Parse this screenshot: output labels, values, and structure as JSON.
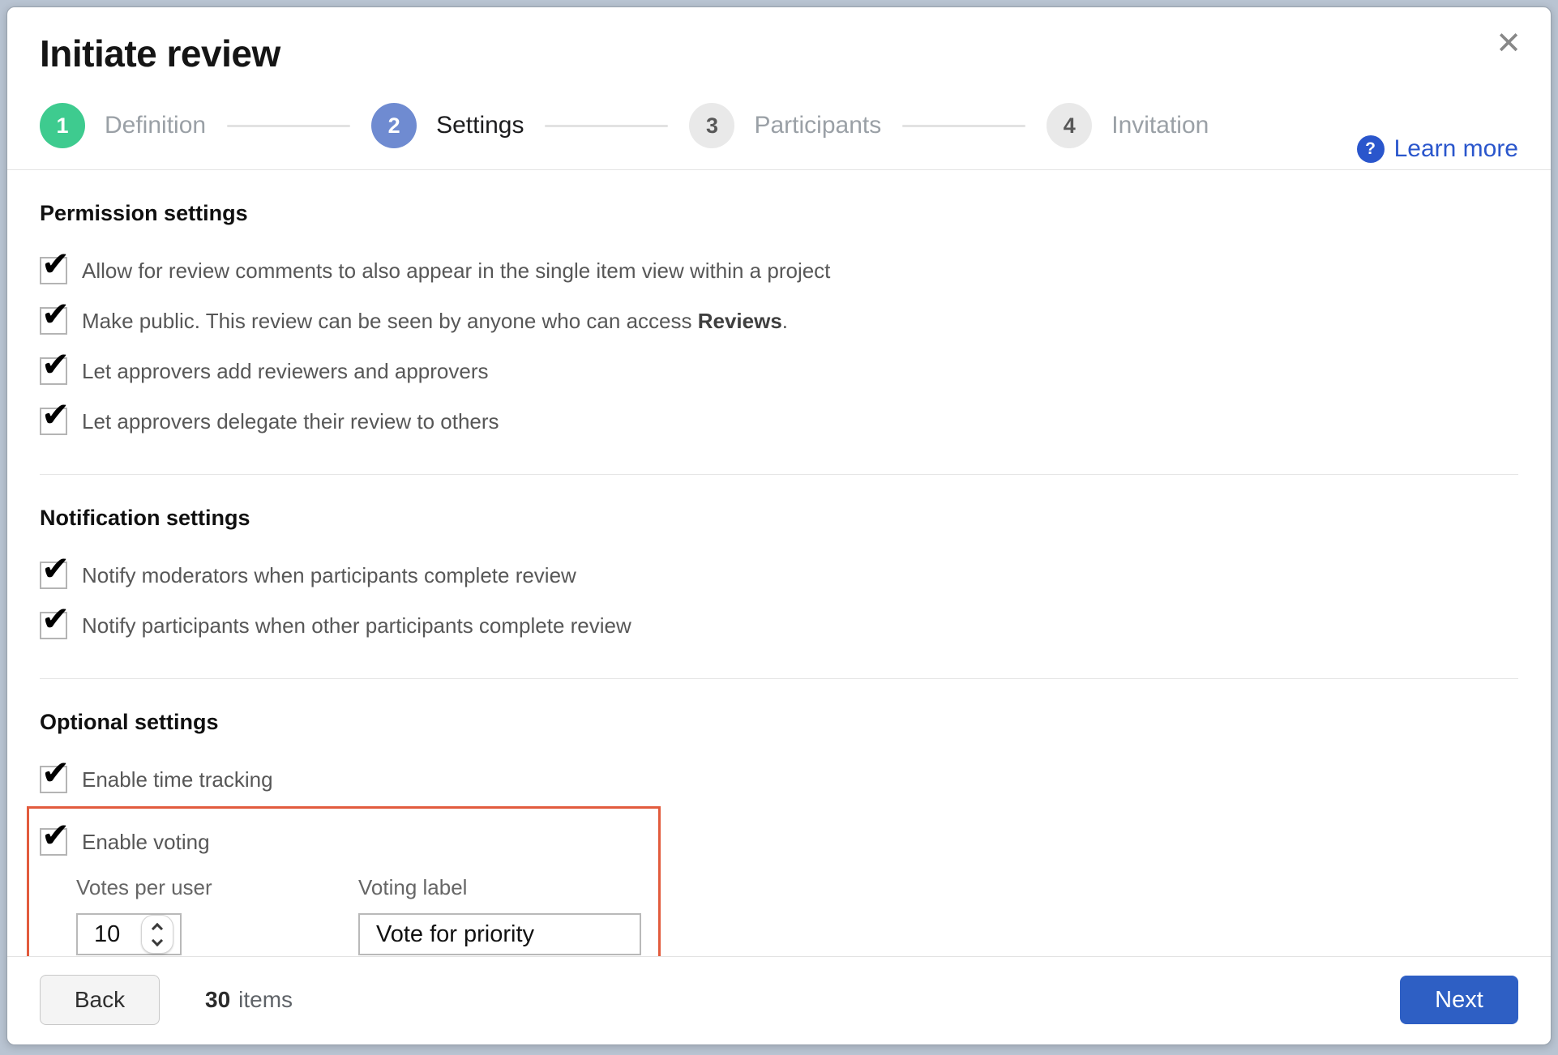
{
  "modal": {
    "title": "Initiate review"
  },
  "icons": {
    "check": "✔",
    "close": "✕",
    "help": "?"
  },
  "header": {
    "learn_more_label": "Learn more"
  },
  "stepper": {
    "steps": [
      {
        "number": "1",
        "label": "Definition",
        "state": "done"
      },
      {
        "number": "2",
        "label": "Settings",
        "state": "active"
      },
      {
        "number": "3",
        "label": "Participants",
        "state": "todo"
      },
      {
        "number": "4",
        "label": "Invitation",
        "state": "todo"
      }
    ]
  },
  "sections": {
    "permission": {
      "heading": "Permission settings",
      "items": [
        {
          "text": "Allow for review comments to also appear in the single item view within a project",
          "bold": "",
          "suffix": ""
        },
        {
          "text": "Make public. This review can be seen by anyone who can access ",
          "bold": "Reviews",
          "suffix": "."
        },
        {
          "text": "Let approvers add reviewers and approvers",
          "bold": "",
          "suffix": ""
        },
        {
          "text": "Let approvers delegate their review to others",
          "bold": "",
          "suffix": ""
        }
      ]
    },
    "notification": {
      "heading": "Notification settings",
      "items": [
        {
          "text": "Notify moderators when participants complete review"
        },
        {
          "text": "Notify participants when other participants complete review"
        }
      ]
    },
    "optional": {
      "heading": "Optional settings",
      "items": [
        {
          "text": "Enable time tracking"
        },
        {
          "text": "Enable voting"
        }
      ]
    }
  },
  "voting": {
    "votes_per_user": {
      "label": "Votes per user",
      "value": "10"
    },
    "voting_label": {
      "label": "Voting label",
      "value": "Vote for priority"
    }
  },
  "footer": {
    "back_label": "Back",
    "items_count": "30",
    "items_label": "items",
    "next_label": "Next"
  },
  "colors": {
    "step_done": "#3ecb8f",
    "step_active": "#6f8bd1",
    "step_todo": "#e9e9e9",
    "link_blue": "#2a56cc",
    "next_button": "#2e5fc4",
    "highlight_orange": "#e25b3d"
  }
}
